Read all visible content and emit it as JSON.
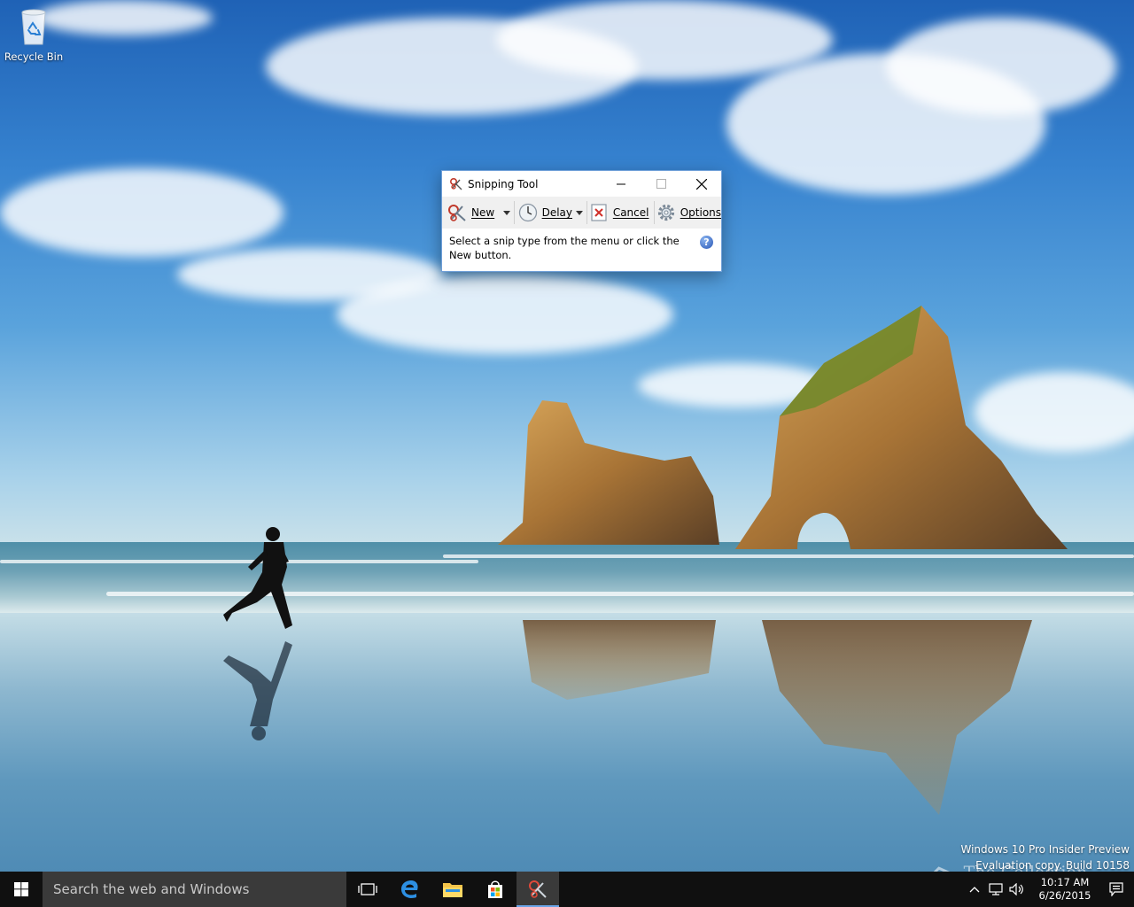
{
  "desktop": {
    "icons": [
      {
        "label": "Recycle Bin",
        "icon": "recycle-bin-icon"
      }
    ],
    "watermark": {
      "line1": "Windows 10 Pro Insider Preview",
      "line2": "Evaluation copy. Build 10158"
    },
    "brand_watermark": "The Collection Book"
  },
  "snipping_tool": {
    "title": "Snipping Tool",
    "toolbar": {
      "new_label": "New",
      "delay_label": "Delay",
      "cancel_label": "Cancel",
      "options_label": "Options"
    },
    "message": "Select a snip type from the menu or click the New button.",
    "help_label": "?",
    "window_buttons": [
      "minimize",
      "maximize",
      "close"
    ]
  },
  "taskbar": {
    "search_placeholder": "Search the web and Windows",
    "pinned": [
      {
        "name": "task-view",
        "icon": "task-view-icon"
      },
      {
        "name": "edge",
        "icon": "edge-icon"
      },
      {
        "name": "file-explorer",
        "icon": "folder-icon"
      },
      {
        "name": "store",
        "icon": "store-icon"
      },
      {
        "name": "snipping-tool",
        "icon": "scissors-icon",
        "active": true
      }
    ],
    "clock": {
      "time": "10:17 AM",
      "date": "6/26/2015"
    }
  },
  "colors": {
    "taskbar_bg": "#101010",
    "search_bg": "#3a3a3a",
    "accent": "#6aa4e8",
    "window_border": "#6f9fd8"
  }
}
